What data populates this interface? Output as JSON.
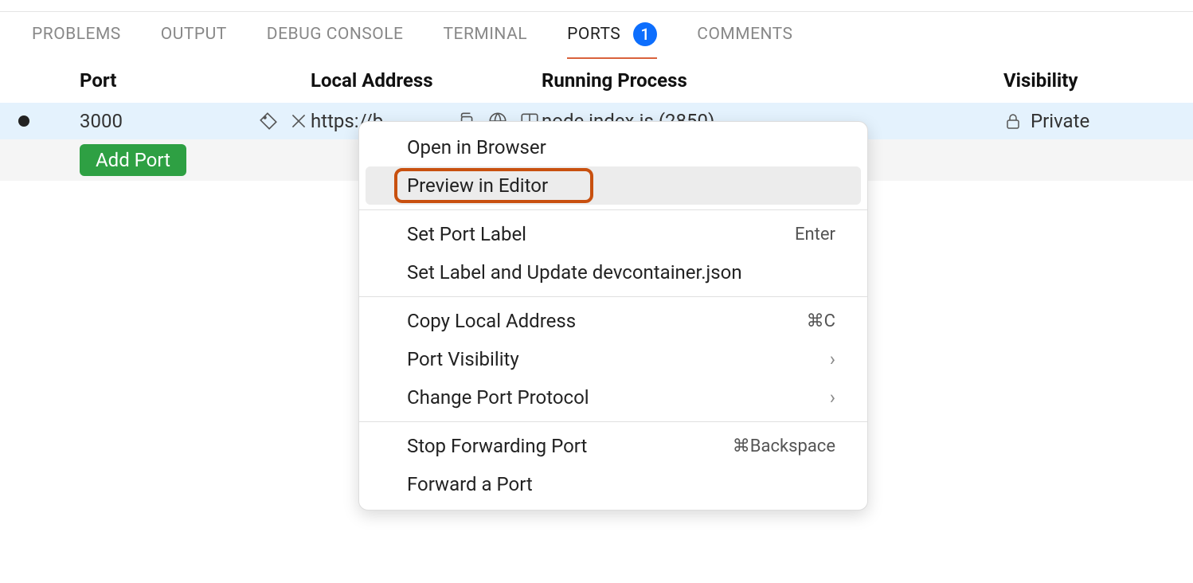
{
  "tabs": {
    "problems": "PROBLEMS",
    "output": "OUTPUT",
    "debug_console": "DEBUG CONSOLE",
    "terminal": "TERMINAL",
    "ports": "PORTS",
    "ports_badge": "1",
    "comments": "COMMENTS"
  },
  "headers": {
    "port": "Port",
    "local_address": "Local Address",
    "running_process": "Running Process",
    "visibility": "Visibility"
  },
  "row": {
    "port": "3000",
    "local_address": "https://b",
    "running_process": "node index.js (2850)",
    "visibility": "Private"
  },
  "add_port_btn": "Add Port",
  "context_menu": {
    "open_in_browser": "Open in Browser",
    "preview_in_editor": "Preview in Editor",
    "set_port_label": "Set Port Label",
    "set_port_label_shortcut": "Enter",
    "set_label_update": "Set Label and Update devcontainer.json",
    "copy_local_address": "Copy Local Address",
    "copy_local_address_shortcut": "⌘C",
    "port_visibility": "Port Visibility",
    "change_port_protocol": "Change Port Protocol",
    "stop_forwarding": "Stop Forwarding Port",
    "stop_forwarding_shortcut": "⌘Backspace",
    "forward_a_port": "Forward a Port"
  }
}
